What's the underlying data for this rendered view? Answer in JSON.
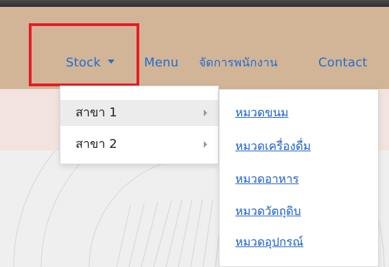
{
  "nav": {
    "stock": "Stock",
    "menu": "Menu",
    "staff": "จัดการพนักงาน",
    "contact": "Contact"
  },
  "dropdown": {
    "items": [
      "สาขา 1",
      "สาขา 2"
    ]
  },
  "submenu": {
    "items": [
      "หมวดขนม",
      "หมวดเครื่องดื่ม",
      "หมวดอาหาร",
      "หมวดวัตถุดิบ",
      "หมวดอุปกรณ์"
    ]
  },
  "icons": {
    "caret": "chevron-down-icon",
    "submenu": "chevron-right-icon"
  },
  "colors": {
    "navbar": "#d2b497",
    "link": "#1f6fd1",
    "highlight": "#e51b25",
    "pink_band": "#f2e3df"
  }
}
